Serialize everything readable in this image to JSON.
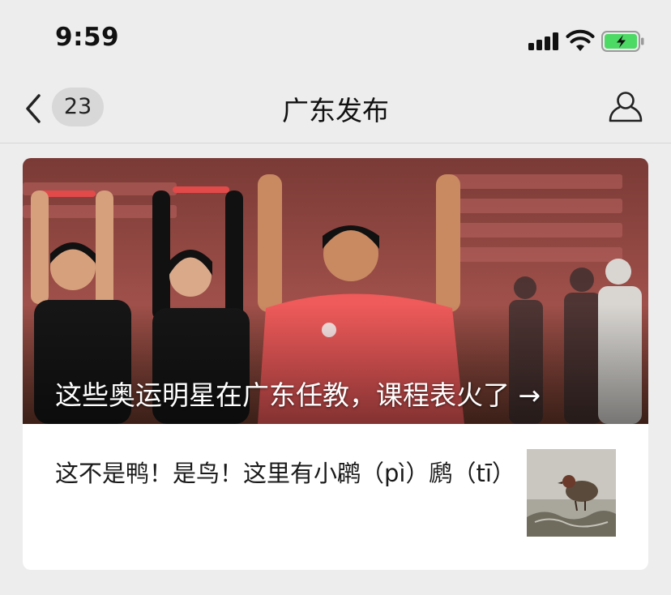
{
  "status_bar": {
    "time": "9:59"
  },
  "nav": {
    "unread_count": "23",
    "title": "广东发布"
  },
  "article": {
    "cover_title": "这些奥运明星在广东任教，课程表火了 →",
    "sub_title": "这不是鸭！是鸟！这里有小䴙（pì）䴘（tī）"
  },
  "icons": {
    "back": "chevron-left-icon",
    "profile": "person-icon",
    "signal": "cellular-signal-icon",
    "wifi": "wifi-icon",
    "battery": "battery-charging-icon"
  },
  "colors": {
    "background": "#ededed",
    "battery_fill": "#4cd964",
    "card": "#ffffff",
    "badge": "#d8d8d8"
  }
}
